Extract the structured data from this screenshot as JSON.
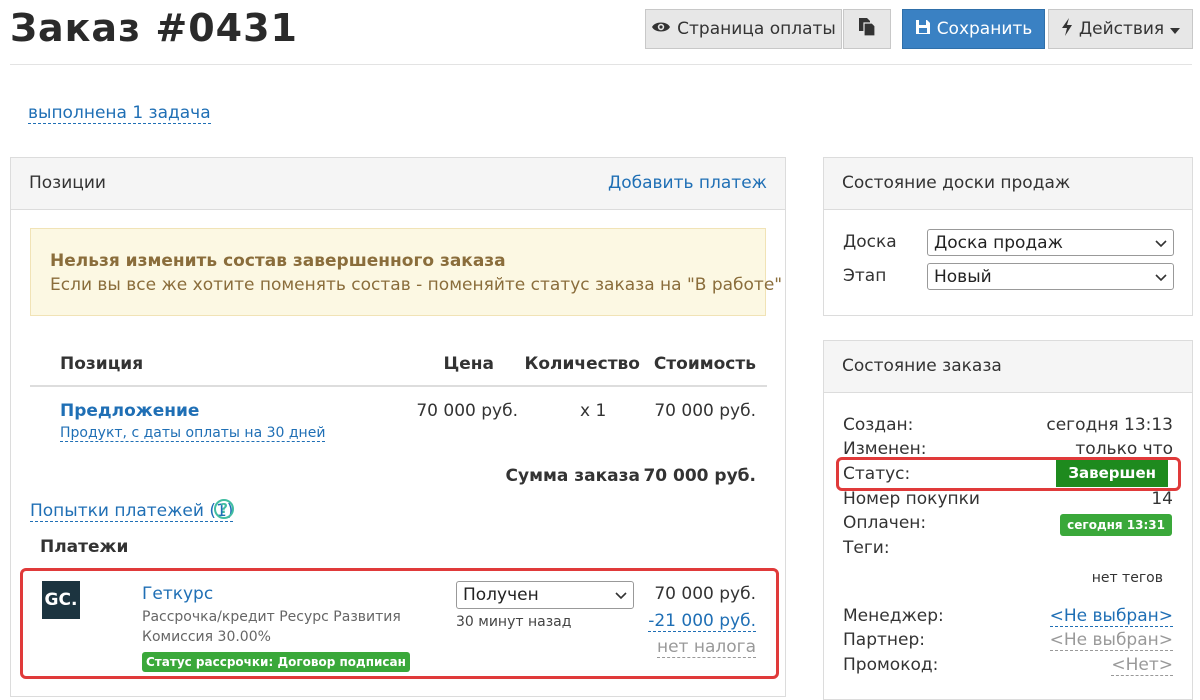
{
  "header": {
    "title": "Заказ #0431",
    "payment_page_label": "Страница оплаты",
    "save_label": "Сохранить",
    "actions_label": "Действия"
  },
  "tasks_link": "выполнена 1 задача",
  "positions_panel": {
    "title": "Позиции",
    "add_payment_label": "Добавить платеж",
    "alert_title": "Нельзя изменить состав завершенного заказа",
    "alert_text": "Если вы все же хотите поменять состав - поменяйте статус заказа на \"В работе\"",
    "columns": {
      "position": "Позиция",
      "price": "Цена",
      "quantity": "Количество",
      "cost": "Стоимость"
    },
    "item": {
      "name": "Предложение",
      "subtitle": "Продукт, с даты оплаты на 30 дней",
      "price": "70 000 руб.",
      "quantity": "x 1",
      "cost": "70 000 руб."
    },
    "total_label": "Сумма заказа",
    "total_value": "70 000 руб.",
    "attempts_link": "Попытки платежей (1)",
    "payments_title": "Платежи",
    "payment": {
      "logo_text": "GC.",
      "provider": "Геткурс",
      "description": "Рассрочка/кредит Ресурс Развития",
      "commission": "Комиссия 30.00%",
      "status_badge": "Статус рассрочки: Договор подписан",
      "status_select": "Получен",
      "time_ago": "30 минут назад",
      "amount": "70 000 руб.",
      "deduction": "-21 000 руб.",
      "tax": "нет налога"
    }
  },
  "sales_board_panel": {
    "title": "Состояние доски продаж",
    "board_label": "Доска",
    "board_value": "Доска продаж",
    "stage_label": "Этап",
    "stage_value": "Новый"
  },
  "order_state_panel": {
    "title": "Состояние заказа",
    "created_label": "Создан:",
    "created_value": "сегодня 13:13",
    "modified_label": "Изменен:",
    "modified_value": "только что",
    "status_label": "Статус:",
    "status_value": "Завершен",
    "purchase_number_label": "Номер покупки",
    "purchase_number_value": "14",
    "paid_label": "Оплачен:",
    "paid_value": "сегодня 13:31",
    "tags_label": "Теги:",
    "tags_value": "нет тегов",
    "manager_label": "Менеджер:",
    "manager_value": "<Не выбран>",
    "partner_label": "Партнер:",
    "partner_value": "<Не выбран>",
    "promo_label": "Промокод:",
    "promo_value": "<Нет>"
  },
  "colors": {
    "primary": "#3a81c3",
    "link": "#1f6fb5",
    "success": "#3aa83a",
    "status_dark_green": "#1e8a1e",
    "highlight_red": "#e03a3a",
    "alert_bg": "#fcf8e3",
    "alert_text": "#8a6d3b"
  },
  "icons": [
    "eye-icon",
    "copy-icon",
    "floppy-disk-icon",
    "lightning-icon",
    "caret-down-icon",
    "question-circle-icon",
    "chevron-down-icon"
  ]
}
